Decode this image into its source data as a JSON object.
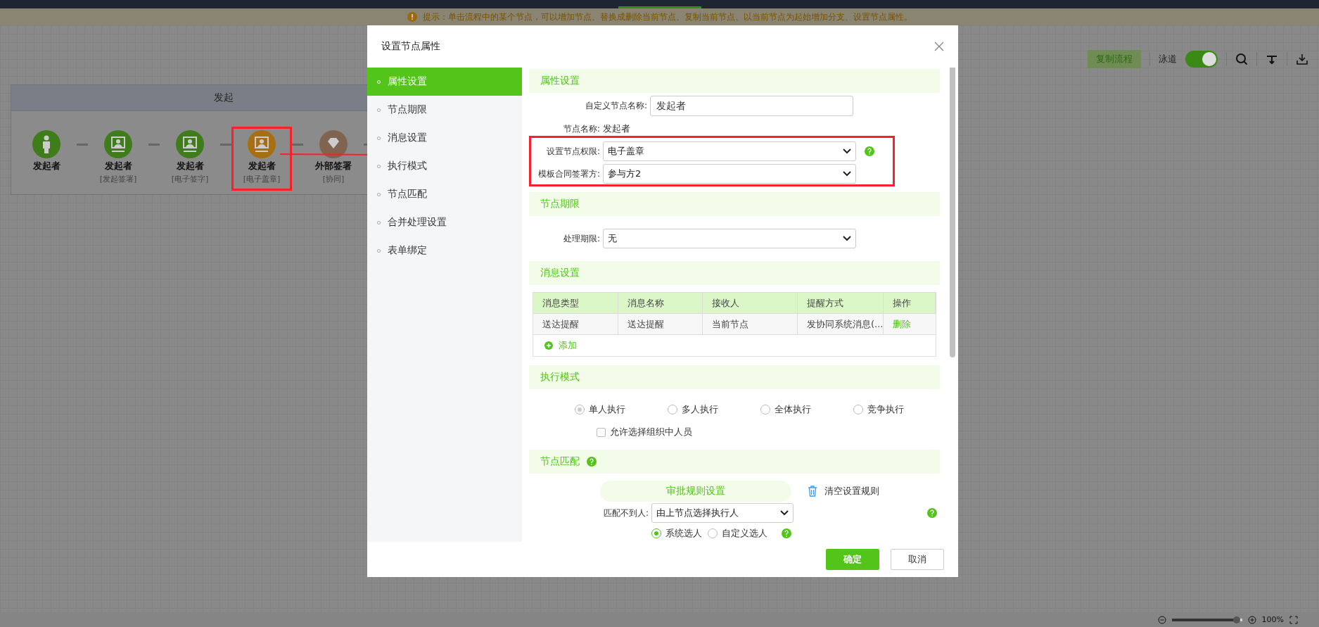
{
  "notice": {
    "text": "提示：单击流程中的某个节点，可以增加节点、替换成删除当前节点、复制当前节点、以当前节点为起始增加分支、设置节点属性。"
  },
  "toolbar": {
    "copy_button": "复制流程",
    "lane_label": "泳道",
    "lane_on": true
  },
  "lane": {
    "title": "发起",
    "nodes": [
      {
        "kind": "person",
        "name": "发起者",
        "color": "#3e7d1a",
        "highlighted": false
      },
      {
        "kind": "signer",
        "name": "发起者",
        "sub": "[发起签署]",
        "color": "#3e7d1a",
        "highlighted": false
      },
      {
        "kind": "signer",
        "name": "发起者",
        "sub": "[电子签字]",
        "color": "#3e7d1a",
        "highlighted": false
      },
      {
        "kind": "signer",
        "name": "发起者",
        "sub": "[电子盖章]",
        "color": "#a86f12",
        "highlighted": true
      },
      {
        "kind": "external",
        "name": "外部签署",
        "sub": "[协同]",
        "color": "#80644f",
        "highlighted": false
      }
    ]
  },
  "zoom": {
    "level": 0.92,
    "reading": "100%"
  },
  "modal": {
    "title": "设置节点属性",
    "nav": [
      {
        "label": "属性设置",
        "selected": true
      },
      {
        "label": "节点期限",
        "selected": false
      },
      {
        "label": "消息设置",
        "selected": false
      },
      {
        "label": "执行模式",
        "selected": false
      },
      {
        "label": "节点匹配",
        "selected": false
      },
      {
        "label": "合并处理设置",
        "selected": false
      },
      {
        "label": "表单绑定",
        "selected": false
      }
    ],
    "attributes": {
      "title": "属性设置",
      "custom_name": {
        "label": "自定义节点名称:",
        "value": "发起者"
      },
      "node_name": {
        "label": "节点名称:",
        "value": "发起者"
      },
      "permission": {
        "label": "设置节点权限:",
        "value": "电子盖章"
      },
      "signer": {
        "label": "模板合同签署方:",
        "value": "参与方2"
      }
    },
    "deadline": {
      "title": "节点期限",
      "label": "处理期限:",
      "value": "无"
    },
    "messages": {
      "title": "消息设置",
      "columns": [
        "消息类型",
        "消息名称",
        "接收人",
        "提醒方式",
        "操作"
      ],
      "rows": [
        {
          "cells": [
            "送达提醒",
            "送达提醒",
            "当前节点",
            "发协同系统消息(..."
          ],
          "action": "删除"
        }
      ],
      "add": "添加"
    },
    "exec_mode": {
      "title": "执行模式",
      "options": [
        {
          "label": "单人执行",
          "selected": true
        },
        {
          "label": "多人执行",
          "selected": false
        },
        {
          "label": "全体执行",
          "selected": false
        },
        {
          "label": "竞争执行",
          "selected": false
        }
      ],
      "allow_org": {
        "label": "允许选择组织中人员",
        "checked": false
      }
    },
    "matching": {
      "title": "节点匹配",
      "rule_button": "审批规则设置",
      "clear": "清空设置规则",
      "label": "匹配不到人:",
      "value": "由上节点选择执行人",
      "options": [
        {
          "label": "系统选人",
          "selected": true
        },
        {
          "label": "自定义选人",
          "selected": false
        }
      ]
    },
    "buttons": {
      "ok": "确定",
      "cancel": "取消"
    }
  }
}
